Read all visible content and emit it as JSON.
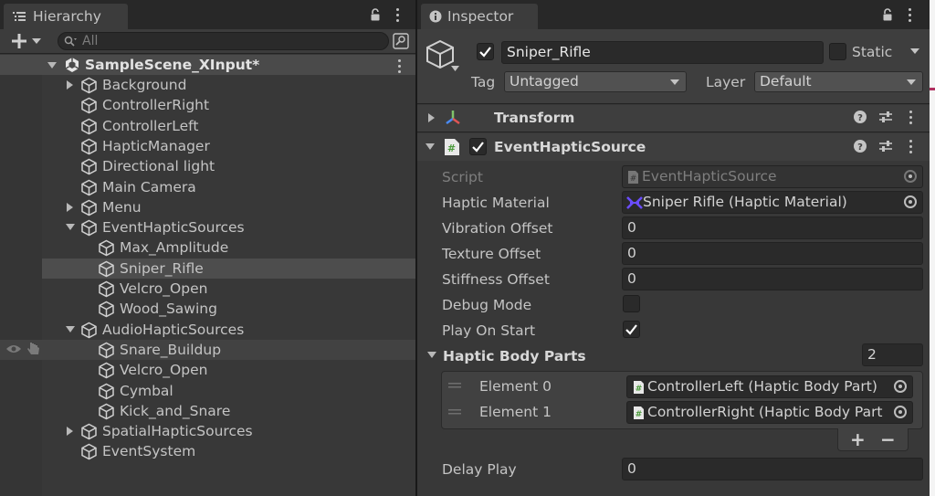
{
  "hierarchy": {
    "tab_label": "Hierarchy",
    "search_placeholder": "All",
    "scene_name": "SampleScene_XInput*",
    "items": [
      {
        "label": "Background",
        "depth": 1,
        "foldout": true
      },
      {
        "label": "ControllerRight",
        "depth": 1,
        "foldout": false
      },
      {
        "label": "ControllerLeft",
        "depth": 1,
        "foldout": false
      },
      {
        "label": "HapticManager",
        "depth": 1,
        "foldout": false
      },
      {
        "label": "Directional light",
        "depth": 1,
        "foldout": false
      },
      {
        "label": "Main Camera",
        "depth": 1,
        "foldout": false
      },
      {
        "label": "Menu",
        "depth": 1,
        "foldout": true
      },
      {
        "label": "EventHapticSources",
        "depth": 1,
        "foldout": true,
        "expanded": true
      },
      {
        "label": "Max_Amplitude",
        "depth": 2,
        "foldout": false
      },
      {
        "label": "Sniper_Rifle",
        "depth": 2,
        "foldout": false,
        "selected": true
      },
      {
        "label": "Velcro_Open",
        "depth": 2,
        "foldout": false
      },
      {
        "label": "Wood_Sawing",
        "depth": 2,
        "foldout": false
      },
      {
        "label": "AudioHapticSources",
        "depth": 1,
        "foldout": true,
        "expanded": true
      },
      {
        "label": "Snare_Buildup",
        "depth": 2,
        "foldout": false,
        "hovered": true
      },
      {
        "label": "Velcro_Open",
        "depth": 2,
        "foldout": false
      },
      {
        "label": "Cymbal",
        "depth": 2,
        "foldout": false
      },
      {
        "label": "Kick_and_Snare",
        "depth": 2,
        "foldout": false
      },
      {
        "label": "SpatialHapticSources",
        "depth": 1,
        "foldout": true
      },
      {
        "label": "EventSystem",
        "depth": 1,
        "foldout": false
      }
    ]
  },
  "inspector": {
    "tab_label": "Inspector",
    "object_name": "Sniper_Rifle",
    "active": true,
    "static_label": "Static",
    "static": false,
    "tag_label": "Tag",
    "tag_value": "Untagged",
    "layer_label": "Layer",
    "layer_value": "Default",
    "transform_label": "Transform",
    "component_label": "EventHapticSource",
    "component_enabled": true,
    "fields": {
      "script_label": "Script",
      "script_value": "EventHapticSource",
      "haptic_material_label": "Haptic Material",
      "haptic_material_value": "Sniper Rifle (Haptic Material)",
      "vibration_offset_label": "Vibration Offset",
      "vibration_offset_value": "0",
      "texture_offset_label": "Texture Offset",
      "texture_offset_value": "0",
      "stiffness_offset_label": "Stiffness Offset",
      "stiffness_offset_value": "0",
      "debug_mode_label": "Debug Mode",
      "debug_mode": false,
      "play_on_start_label": "Play On Start",
      "play_on_start": true,
      "body_parts_label": "Haptic Body Parts",
      "body_parts_count": "2",
      "elements": [
        {
          "label": "Element 0",
          "value": "ControllerLeft (Haptic Body Part)"
        },
        {
          "label": "Element 1",
          "value": "ControllerRight (Haptic Body Part"
        }
      ],
      "add_label": "+",
      "remove_label": "−",
      "delay_play_label": "Delay Play",
      "delay_play_value": "0"
    }
  },
  "colors": {
    "accent_check": "#ffffff",
    "haptic_material_icon": "#6a4cff",
    "script_icon": "#7fc36a"
  }
}
